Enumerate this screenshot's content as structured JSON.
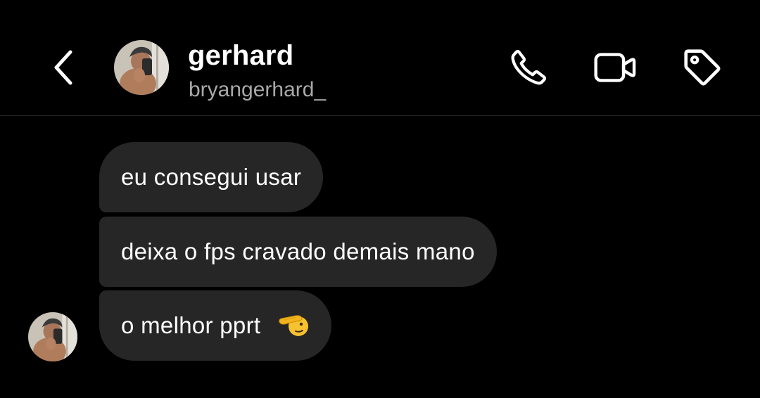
{
  "header": {
    "name": "gerhard",
    "username": "bryangerhard_"
  },
  "icons": {
    "back": "chevron-left-icon",
    "avatar": "profile-photo",
    "call": "phone-icon",
    "video": "video-camera-icon",
    "tag": "tag-icon",
    "emoji": "saluting-face-emoji"
  },
  "messages": [
    {
      "text": "eu consegui usar"
    },
    {
      "text": "deixa o fps cravado demais mano"
    },
    {
      "text": "o melhor pprt"
    }
  ],
  "colors": {
    "background": "#000000",
    "bubble": "#262626",
    "username": "#a8a8a8",
    "divider": "#262626"
  }
}
